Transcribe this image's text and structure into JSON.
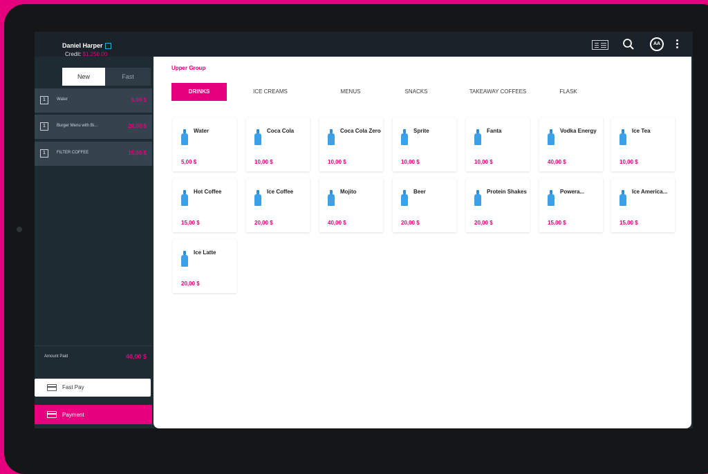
{
  "header": {
    "user_name": "Daniel Harper",
    "credits_label": "Credit:",
    "credits_value": "$1,250.00",
    "avatar_initials": "AA"
  },
  "sidebar": {
    "tabs": [
      {
        "label": "New"
      },
      {
        "label": "Fast"
      }
    ],
    "order_items": [
      {
        "qty": "1",
        "name": "Water",
        "price": "5,00 $"
      },
      {
        "qty": "1",
        "name": "Burger Menu with Bi...",
        "price": "20,00 $"
      },
      {
        "qty": "1",
        "name": "FILTER COFFEE",
        "price": "15,00 $"
      }
    ],
    "amount_label": "Amount Paid",
    "amount_value": "40,00 $",
    "fast_pay_label": "Fast Pay",
    "payment_label": "Payment"
  },
  "main": {
    "group_label": "Upper Group",
    "categories": [
      {
        "label": "DRINKS"
      },
      {
        "label": "ICE CREAMS"
      },
      {
        "label": "MENUS"
      },
      {
        "label": "SNACKS"
      },
      {
        "label": "TAKEAWAY COFFEES"
      },
      {
        "label": "FLASK"
      }
    ],
    "active_category": "DRINKS",
    "products": [
      {
        "name": "Water",
        "price": "5,00 $"
      },
      {
        "name": "Coca Cola",
        "price": "10,00 $"
      },
      {
        "name": "Coca Cola Zero",
        "price": "10,00 $"
      },
      {
        "name": "Sprite",
        "price": "10,00 $"
      },
      {
        "name": "Fanta",
        "price": "10,00 $"
      },
      {
        "name": "Vodka Energy",
        "price": "40,00 $"
      },
      {
        "name": "Ice Tea",
        "price": "10,00 $"
      },
      {
        "name": "Hot Coffee",
        "price": "15,00 $"
      },
      {
        "name": "Ice Coffee",
        "price": "20,00 $"
      },
      {
        "name": "Mojito",
        "price": "40,00 $"
      },
      {
        "name": "Beer",
        "price": "20,00 $"
      },
      {
        "name": "Protein Shakes",
        "price": "20,00 $"
      },
      {
        "name": "Powera...",
        "price": "15,00 $"
      },
      {
        "name": "Ice America...",
        "price": "15,00 $"
      },
      {
        "name": "Ice Latte",
        "price": "20,00 $"
      }
    ]
  },
  "colors": {
    "accent": "#e6007e",
    "sidebar_bg": "#1f2b33",
    "bottle_icon": "#3aa0e8"
  }
}
